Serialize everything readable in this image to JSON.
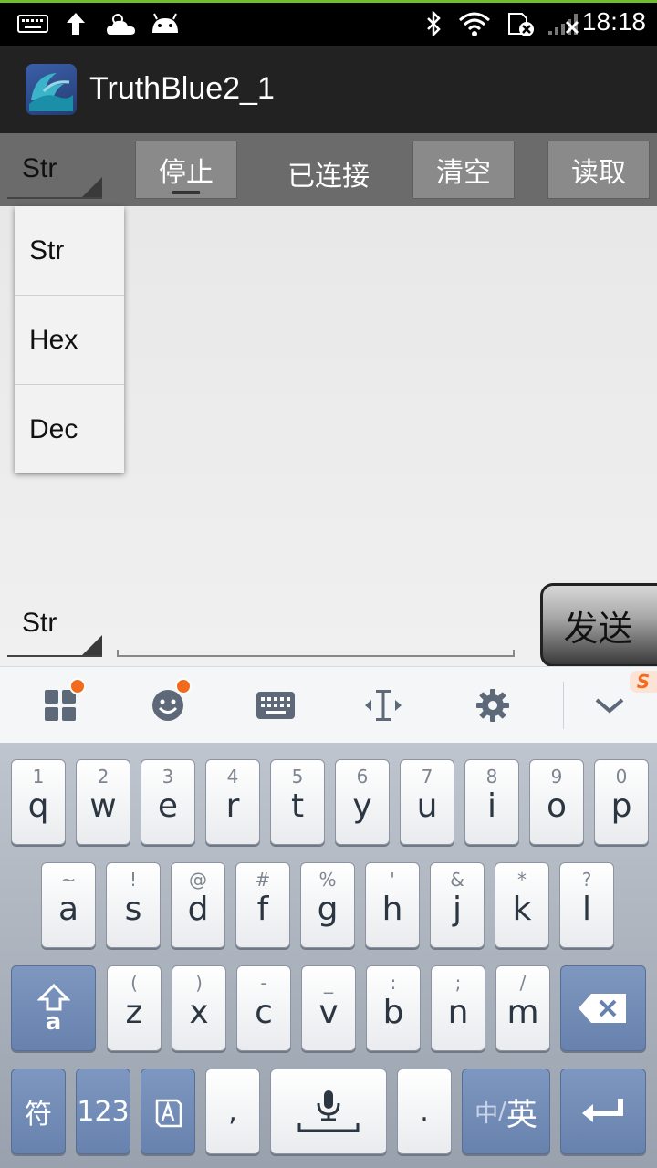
{
  "status_bar": {
    "time": "18:18",
    "icons": [
      "keyboard-icon",
      "upload-arrow-icon",
      "weather-cloud-icon",
      "android-icon",
      "bluetooth-icon",
      "wifi-icon",
      "sim-error-icon",
      "signal-no-service-icon"
    ]
  },
  "app": {
    "title": "TruthBlue2_1"
  },
  "toolbar": {
    "receive_format": "Str",
    "stop_label": "停止",
    "status_label": "已连接",
    "clear_label": "清空",
    "read_label": "读取"
  },
  "dropdown": {
    "options": [
      "Str",
      "Hex",
      "Dec"
    ]
  },
  "send_bar": {
    "send_format": "Str",
    "input_value": "",
    "send_label": "发送"
  },
  "keyboard_toolbar": {
    "icons": [
      "apps-grid-icon",
      "emoji-icon",
      "keyboard-icon",
      "text-cursor-icon",
      "settings-gear-icon",
      "chevron-down-icon"
    ],
    "badge": "S"
  },
  "keyboard": {
    "row1": [
      {
        "sub": "1",
        "main": "q"
      },
      {
        "sub": "2",
        "main": "w"
      },
      {
        "sub": "3",
        "main": "e"
      },
      {
        "sub": "4",
        "main": "r"
      },
      {
        "sub": "5",
        "main": "t"
      },
      {
        "sub": "6",
        "main": "y"
      },
      {
        "sub": "7",
        "main": "u"
      },
      {
        "sub": "8",
        "main": "i"
      },
      {
        "sub": "9",
        "main": "o"
      },
      {
        "sub": "0",
        "main": "p"
      }
    ],
    "row2": [
      {
        "sub": "~",
        "main": "a"
      },
      {
        "sub": "!",
        "main": "s"
      },
      {
        "sub": "@",
        "main": "d"
      },
      {
        "sub": "#",
        "main": "f"
      },
      {
        "sub": "%",
        "main": "g"
      },
      {
        "sub": "'",
        "main": "h"
      },
      {
        "sub": "&",
        "main": "j"
      },
      {
        "sub": "*",
        "main": "k"
      },
      {
        "sub": "?",
        "main": "l"
      }
    ],
    "row3": [
      {
        "sub": "(",
        "main": "z"
      },
      {
        "sub": ")",
        "main": "x"
      },
      {
        "sub": "-",
        "main": "c"
      },
      {
        "sub": "_",
        "main": "v"
      },
      {
        "sub": ":",
        "main": "b"
      },
      {
        "sub": ";",
        "main": "n"
      },
      {
        "sub": "/",
        "main": "m"
      }
    ],
    "shift_label": "a",
    "symbols_label": "符",
    "numbers_label": "123",
    "comma_label": ",",
    "period_label": ".",
    "lang_cn": "中",
    "lang_sep": "/",
    "lang_en": "英"
  }
}
